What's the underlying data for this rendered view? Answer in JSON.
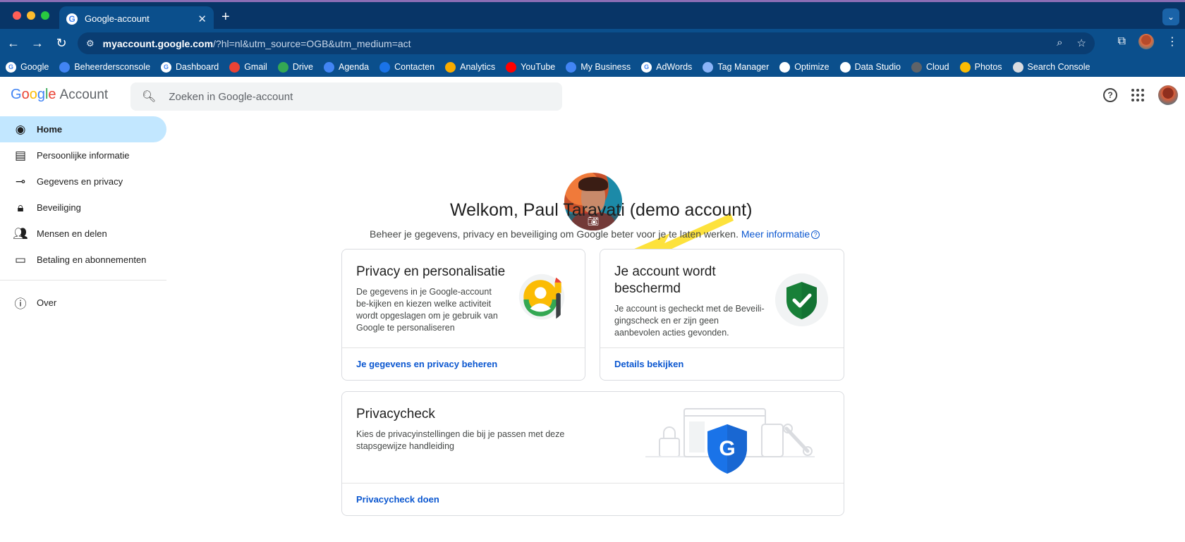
{
  "browser": {
    "tab_title": "Google-account",
    "url_host": "myaccount.google.com",
    "url_path": "/?hl=nl&utm_source=OGB&utm_medium=act",
    "bookmarks": [
      {
        "label": "Google",
        "color": "#ffffff",
        "icon": "google-icon"
      },
      {
        "label": "Beheerdersconsole",
        "color": "#4285f4",
        "icon": "admin-console-icon"
      },
      {
        "label": "Dashboard",
        "color": "#ffffff",
        "icon": "google-icon"
      },
      {
        "label": "Gmail",
        "color": "#ea4335",
        "icon": "gmail-icon"
      },
      {
        "label": "Drive",
        "color": "#34a853",
        "icon": "drive-icon"
      },
      {
        "label": "Agenda",
        "color": "#4285f4",
        "icon": "calendar-icon"
      },
      {
        "label": "Contacten",
        "color": "#1a73e8",
        "icon": "contacts-icon"
      },
      {
        "label": "Analytics",
        "color": "#f9ab00",
        "icon": "analytics-icon"
      },
      {
        "label": "YouTube",
        "color": "#ff0000",
        "icon": "youtube-icon"
      },
      {
        "label": "My Business",
        "color": "#4285f4",
        "icon": "my-business-icon"
      },
      {
        "label": "AdWords",
        "color": "#ffffff",
        "icon": "google-icon"
      },
      {
        "label": "Tag Manager",
        "color": "#8ab4f8",
        "icon": "tag-manager-icon"
      },
      {
        "label": "Optimize",
        "color": "#ffffff",
        "icon": "globe-icon"
      },
      {
        "label": "Data Studio",
        "color": "#ffffff",
        "icon": "globe-icon"
      },
      {
        "label": "Cloud",
        "color": "#5f6368",
        "icon": "cloud-icon"
      },
      {
        "label": "Photos",
        "color": "#fbbc04",
        "icon": "photos-icon"
      },
      {
        "label": "Search Console",
        "color": "#dadce0",
        "icon": "search-console-icon"
      }
    ]
  },
  "header": {
    "logo_google": "Google",
    "logo_account": "Account",
    "search_placeholder": "Zoeken in Google-account"
  },
  "sidebar": {
    "items": [
      {
        "label": "Home",
        "icon": "account-circle-icon",
        "active": true
      },
      {
        "label": "Persoonlijke informatie",
        "icon": "id-card-icon"
      },
      {
        "label": "Gegevens en privacy",
        "icon": "toggle-icon"
      },
      {
        "label": "Beveiliging",
        "icon": "lock-icon"
      },
      {
        "label": "Mensen en delen",
        "icon": "people-icon"
      },
      {
        "label": "Betaling en abonnementen",
        "icon": "credit-card-icon"
      }
    ],
    "about": {
      "label": "Over",
      "icon": "info-icon"
    }
  },
  "main": {
    "welcome": "Welkom, Paul Taravati (demo account)",
    "intro": "Beheer je gegevens, privacy en beveiliging om Google beter voor je te laten werken.",
    "more_info": "Meer informatie",
    "cards": {
      "privacy": {
        "title": "Privacy en personalisatie",
        "body": "De gegevens in je Google-account be-kijken en kiezen welke activiteit wordt opgeslagen om je gebruik van Google te personaliseren",
        "link": "Je gegevens en privacy beheren"
      },
      "security": {
        "title": "Je account wordt beschermd",
        "body": "Je account is gecheckt met de Beveili-gingscheck en er zijn geen aanbevolen acties gevonden.",
        "link": "Details bekijken"
      },
      "privacycheck": {
        "title": "Privacycheck",
        "body": "Kies de privacyinstellingen die bij je passen met deze stapsgewijze handleiding",
        "link": "Privacycheck doen"
      }
    }
  },
  "colors": {
    "accent": "#0b57d0",
    "active_nav": "#c2e7ff",
    "chrome": "#0b4f8c",
    "arrow": "#fde23c"
  }
}
